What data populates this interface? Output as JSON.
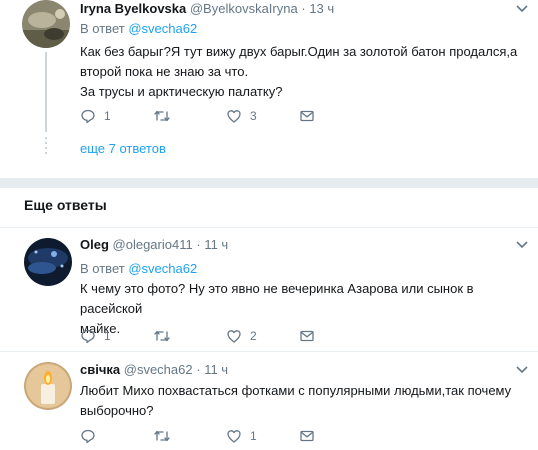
{
  "tweets": [
    {
      "name": "Iryna Byelkovska",
      "handle": "@ByelkovskaIryna",
      "separator": "·",
      "time": "13 ч",
      "reply_prefix": "В ответ",
      "reply_to": "@svecha62",
      "text_lines": [
        "Как без барыг?Я тут вижу двух барыг.Один за золотой батон продался,а",
        "второй пока не знаю за что.",
        "За трусы и арктическую палатку?"
      ],
      "replies": "1",
      "retweets": "",
      "likes": "3"
    },
    {
      "name": "Oleg",
      "handle": "@olegario411",
      "separator": "·",
      "time": "11 ч",
      "reply_prefix": "В ответ",
      "reply_to": "@svecha62",
      "text_lines": [
        "К чему это фото? Ну это явно не вечеринка Азарова или сынок в расейской",
        "майке."
      ],
      "replies": "1",
      "retweets": "",
      "likes": "2"
    },
    {
      "name": "свічка",
      "handle": "@svecha62",
      "separator": "·",
      "time": "11 ч",
      "text_lines": [
        "Любит Михо похвастаться фотками с популярными людьми,так почему",
        "выборочно?"
      ],
      "replies": "",
      "retweets": "",
      "likes": "1"
    }
  ],
  "more_replies": "еще 7 ответов",
  "section_title": "Еще ответы",
  "colors": {
    "link": "#1da1f2",
    "secondary_text": "#657786",
    "divider": "#e6ecf0",
    "thread_line": "#ccd6dd"
  }
}
